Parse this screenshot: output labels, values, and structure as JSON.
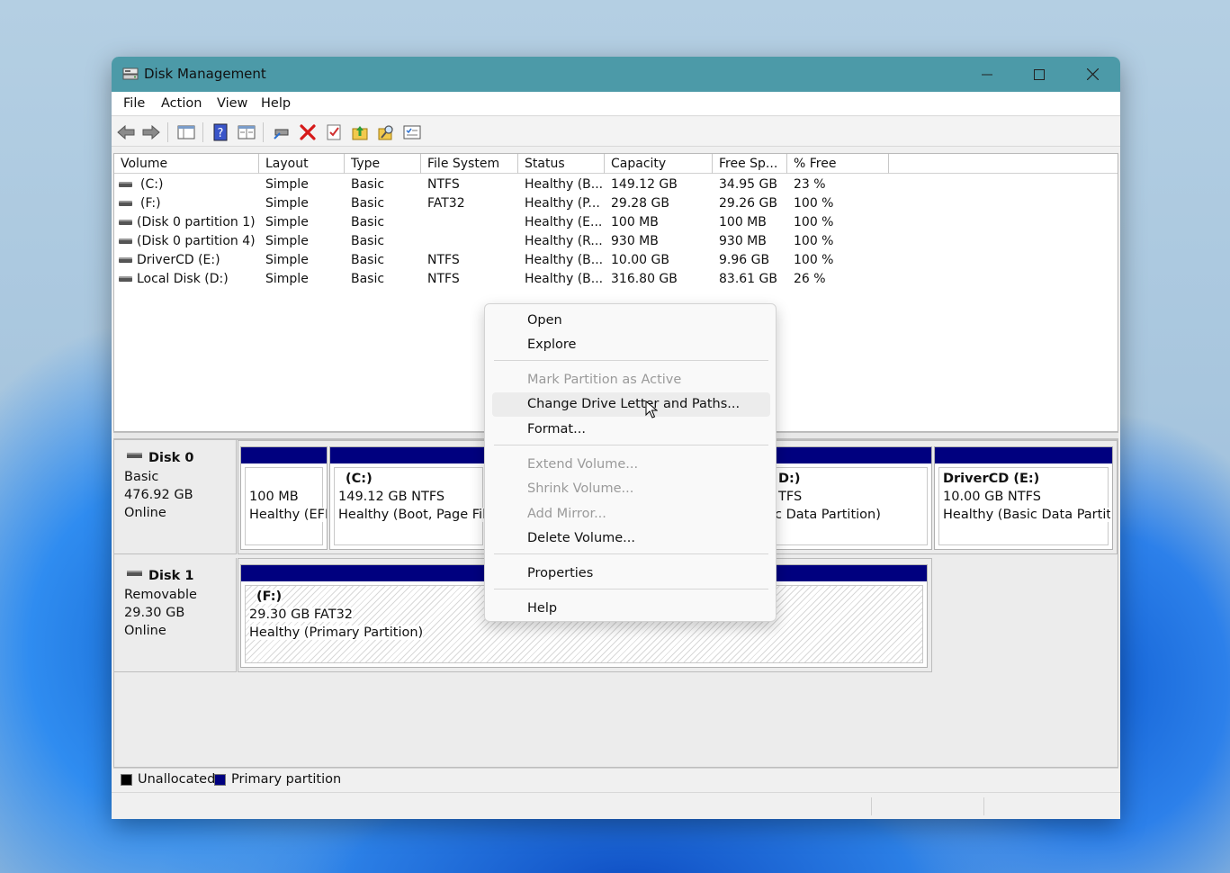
{
  "window": {
    "title": "Disk Management",
    "menu": [
      "File",
      "Action",
      "View",
      "Help"
    ]
  },
  "volume_list": {
    "columns": [
      "Volume",
      "Layout",
      "Type",
      "File System",
      "Status",
      "Capacity",
      "Free Sp...",
      "% Free"
    ],
    "rows": [
      {
        "volume": "(C:)",
        "layout": "Simple",
        "type": "Basic",
        "fs": "NTFS",
        "status": "Healthy (B...",
        "capacity": "149.12 GB",
        "free": "34.95 GB",
        "pct": "23 %"
      },
      {
        "volume": "(F:)",
        "layout": "Simple",
        "type": "Basic",
        "fs": "FAT32",
        "status": "Healthy (P...",
        "capacity": "29.28 GB",
        "free": "29.26 GB",
        "pct": "100 %"
      },
      {
        "volume": "(Disk 0 partition 1)",
        "layout": "Simple",
        "type": "Basic",
        "fs": "",
        "status": "Healthy (E...",
        "capacity": "100 MB",
        "free": "100 MB",
        "pct": "100 %"
      },
      {
        "volume": "(Disk 0 partition 4)",
        "layout": "Simple",
        "type": "Basic",
        "fs": "",
        "status": "Healthy (R...",
        "capacity": "930 MB",
        "free": "930 MB",
        "pct": "100 %"
      },
      {
        "volume": "DriverCD (E:)",
        "layout": "Simple",
        "type": "Basic",
        "fs": "NTFS",
        "status": "Healthy (B...",
        "capacity": "10.00 GB",
        "free": "9.96 GB",
        "pct": "100 %"
      },
      {
        "volume": "Local Disk (D:)",
        "layout": "Simple",
        "type": "Basic",
        "fs": "NTFS",
        "status": "Healthy (B...",
        "capacity": "316.80 GB",
        "free": "83.61 GB",
        "pct": "26 %"
      }
    ]
  },
  "disks": [
    {
      "name": "Disk 0",
      "type": "Basic",
      "size": "476.92 GB",
      "state": "Online",
      "partitions": [
        {
          "line1": "",
          "line2": "100 MB",
          "line3": "Healthy (EFI"
        },
        {
          "line1": "(C:)",
          "line2": "149.12 GB NTFS",
          "line3": "Healthy (Boot, Page File,"
        },
        {
          "line1": "D:)",
          "line2": "TFS",
          "line3": "c Data Partition)"
        },
        {
          "line1": "DriverCD  (E:)",
          "line2": "10.00 GB NTFS",
          "line3": "Healthy (Basic Data Partitio"
        }
      ]
    },
    {
      "name": "Disk 1",
      "type": "Removable",
      "size": "29.30 GB",
      "state": "Online",
      "partitions": [
        {
          "line1": "(F:)",
          "line2": "29.30 GB FAT32",
          "line3": "Healthy (Primary Partition)"
        }
      ]
    }
  ],
  "legend": {
    "unallocated": "Unallocated",
    "primary": "Primary partition",
    "unallocated_color": "#000000",
    "primary_color": "#00007f"
  },
  "context_menu": {
    "items": [
      {
        "label": "Open",
        "disabled": false
      },
      {
        "label": "Explore",
        "disabled": false
      },
      {
        "label": "Mark Partition as Active",
        "disabled": true
      },
      {
        "label": "Change Drive Letter and Paths...",
        "disabled": false,
        "hover": true
      },
      {
        "label": "Format...",
        "disabled": false
      },
      {
        "label": "Extend Volume...",
        "disabled": true
      },
      {
        "label": "Shrink Volume...",
        "disabled": true
      },
      {
        "label": "Add Mirror...",
        "disabled": true
      },
      {
        "label": "Delete Volume...",
        "disabled": false
      },
      {
        "label": "Properties",
        "disabled": false
      },
      {
        "label": "Help",
        "disabled": false
      }
    ]
  },
  "colors": {
    "titlebar": "#4c9aa8",
    "partition_bar": "#00007f"
  }
}
